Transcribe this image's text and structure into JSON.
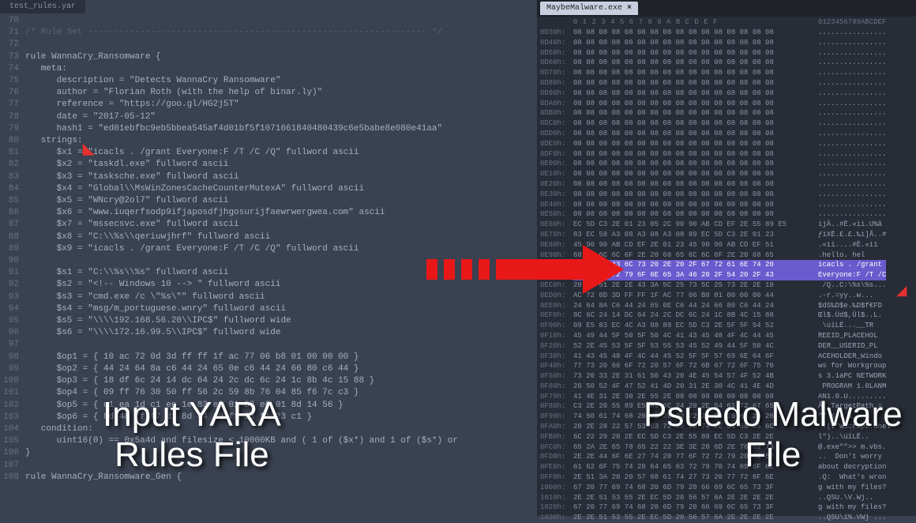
{
  "leftPanel": {
    "tab": "test_rules.yar",
    "lines": [
      {
        "n": 70,
        "t": ""
      },
      {
        "n": 71,
        "t": "/* Rule Set ----------------------------------------------------------------- */",
        "cls": "cmt"
      },
      {
        "n": 72,
        "t": ""
      },
      {
        "n": 73,
        "t": "rule WannaCry_Ransomware {"
      },
      {
        "n": 74,
        "t": "   meta:"
      },
      {
        "n": 75,
        "t": "      description = \"Detects WannaCry Ransomware\""
      },
      {
        "n": 76,
        "t": "      author = \"Florian Roth (with the help of binar.ly)\""
      },
      {
        "n": 77,
        "t": "      reference = \"https://goo.gl/HG2j5T\""
      },
      {
        "n": 78,
        "t": "      date = \"2017-05-12\""
      },
      {
        "n": 79,
        "t": "      hash1 = \"ed01ebfbc9eb5bbea545af4d01bf5f1071661840480439c6e5babe8e080e41aa\""
      },
      {
        "n": 80,
        "t": "   strings:"
      },
      {
        "n": 81,
        "t": "      $x1 = \"icacls . /grant Everyone:F /T /C /Q\" fullword ascii"
      },
      {
        "n": 82,
        "t": "      $x2 = \"taskdl.exe\" fullword ascii"
      },
      {
        "n": 83,
        "t": "      $x3 = \"tasksche.exe\" fullword ascii"
      },
      {
        "n": 84,
        "t": "      $x4 = \"Global\\\\MsWinZonesCacheCounterMutexA\" fullword ascii"
      },
      {
        "n": 85,
        "t": "      $x5 = \"WNcry@2ol7\" fullword ascii"
      },
      {
        "n": 86,
        "t": "      $x6 = \"www.iuqerfsodp9ifjaposdfjhgosurijfaewrwergwea.com\" ascii"
      },
      {
        "n": 87,
        "t": "      $x7 = \"mssecsvc.exe\" fullword ascii"
      },
      {
        "n": 88,
        "t": "      $x8 = \"C:\\\\%s\\\\qeriuwjhrf\" fullword ascii"
      },
      {
        "n": 89,
        "t": "      $x9 = \"icacls . /grant Everyone:F /T /C /Q\" fullword ascii"
      },
      {
        "n": 90,
        "t": ""
      },
      {
        "n": 91,
        "t": "      $s1 = \"C:\\\\%s\\\\%s\" fullword ascii"
      },
      {
        "n": 92,
        "t": "      $s2 = \"<!-- Windows 10 --> \" fullword ascii"
      },
      {
        "n": 93,
        "t": "      $s3 = \"cmd.exe /c \\\"%s\\\"\" fullword ascii"
      },
      {
        "n": 94,
        "t": "      $s4 = \"msg/m_portuguese.wnry\" fullword ascii"
      },
      {
        "n": 95,
        "t": "      $s5 = \"\\\\\\\\192.168.56.20\\\\IPC$\" fullword wide"
      },
      {
        "n": 96,
        "t": "      $s6 = \"\\\\\\\\172.16.99.5\\\\IPC$\" fullword wide"
      },
      {
        "n": 97,
        "t": ""
      },
      {
        "n": 98,
        "t": "      $op1 = { 10 ac 72 0d 3d ff ff 1f ac 77 06 b8 01 00 00 00 }"
      },
      {
        "n": 99,
        "t": "      $op2 = { 44 24 64 8a c6 44 24 65 0e c6 44 24 66 80 c6 44 }"
      },
      {
        "n": 100,
        "t": "      $op3 = { 18 df 6c 24 14 dc 64 24 2c dc 6c 24 1c 8b 4c 15 88 }"
      },
      {
        "n": 101,
        "t": "      $op4 = { 09 ff 76 30 50 ff 56 2c 59 8b 76 04 85 f6 7c c3 }"
      },
      {
        "n": 102,
        "t": "      $op5 = { c1 ea 1d c1 ee 1e 83 e2 01 83 e6 01 8d 14 56 }"
      },
      {
        "n": 103,
        "t": "      $op6 = { 8d 48 ff f7 d1 8d 44 10 ff 23 f1 23 c1 }"
      },
      {
        "n": 104,
        "t": "   condition:"
      },
      {
        "n": 105,
        "t": "      uint16(0) == 0x5a4d and filesize < 10000KB and ( 1 of ($x*) and 1 of ($s*) or"
      },
      {
        "n": 106,
        "t": "}"
      },
      {
        "n": 107,
        "t": ""
      },
      {
        "n": 108,
        "t": "rule WannaCry_Ransomware_Gen {"
      }
    ]
  },
  "rightPanel": {
    "tab": "MaybeMalware.exe",
    "header": {
      "offsets": "0 1 2 3 4 5 6 7 8 9 A B C D E F",
      "ascii": "0123456789ABCDEF"
    },
    "rows": [
      {
        "off": "0D30h:",
        "b": "08 08 08 08 08 08 08 08 08 08 08 08 08 08 08 08",
        "a": "................"
      },
      {
        "off": "0D40h:",
        "b": "08 08 08 08 08 08 08 08 08 08 08 08 08 08 08 08",
        "a": "................"
      },
      {
        "off": "0D50h:",
        "b": "08 08 08 08 08 08 08 08 08 08 08 08 08 08 08 08",
        "a": "................"
      },
      {
        "off": "0D60h:",
        "b": "08 08 08 08 08 08 08 08 08 08 08 08 08 08 08 08",
        "a": "................"
      },
      {
        "off": "0D70h:",
        "b": "08 08 08 08 08 08 08 08 08 08 08 08 08 08 08 08",
        "a": "................"
      },
      {
        "off": "0D80h:",
        "b": "08 08 08 08 08 08 08 08 08 08 08 08 08 08 08 08",
        "a": "................"
      },
      {
        "off": "0D90h:",
        "b": "08 08 08 08 08 08 08 08 08 08 08 08 08 08 08 08",
        "a": "................"
      },
      {
        "off": "0DA0h:",
        "b": "08 08 08 08 08 08 08 08 08 08 08 08 08 08 08 08",
        "a": "................"
      },
      {
        "off": "0DB0h:",
        "b": "08 08 08 08 08 08 08 08 08 08 08 08 08 08 08 08",
        "a": "................"
      },
      {
        "off": "0DC0h:",
        "b": "08 08 08 08 08 08 08 08 08 08 08 08 08 08 08 08",
        "a": "................"
      },
      {
        "off": "0DD0h:",
        "b": "08 08 08 08 08 08 08 08 08 08 08 08 08 08 08 08",
        "a": "................"
      },
      {
        "off": "0DE0h:",
        "b": "08 08 08 08 08 08 08 08 08 08 08 08 08 08 08 08",
        "a": "................"
      },
      {
        "off": "0DF0h:",
        "b": "08 08 08 08 08 08 08 08 08 08 08 08 08 08 08 08",
        "a": "................"
      },
      {
        "off": "0E00h:",
        "b": "08 08 08 08 08 08 08 08 08 08 08 08 08 08 08 08",
        "a": "................"
      },
      {
        "off": "0E10h:",
        "b": "08 08 08 08 08 08 08 08 08 08 08 08 08 08 08 08",
        "a": "................"
      },
      {
        "off": "0E20h:",
        "b": "08 08 08 08 08 08 08 08 08 08 08 08 08 08 08 08",
        "a": "................"
      },
      {
        "off": "0E30h:",
        "b": "08 08 08 08 08 08 08 08 08 08 08 08 08 08 08 08",
        "a": "................"
      },
      {
        "off": "0E40h:",
        "b": "08 08 08 08 08 08 08 08 08 08 08 08 08 08 08 08",
        "a": "................"
      },
      {
        "off": "0E50h:",
        "b": "08 08 08 08 08 08 08 08 08 08 08 08 08 08 08 08",
        "a": "................"
      },
      {
        "off": "0E60h:",
        "b": "EC 5D C3 2E 01 23 05 2C 90 90 AB CD EF 2E 55 89 E5",
        "a": "ìjÂ..#Ë.«ìì.U%â"
      },
      {
        "off": "0E70h:",
        "b": "83 EC 58 A3 08 A3 08 A3 08 89 EC 5D C3 2E 01 23",
        "a": "ƒìXË.£.£.‰ì]Ã..#"
      },
      {
        "off": "0E80h:",
        "b": "45 90 90 AB CD EF 2E 01 23 45 90 90 AB CD EF 51",
        "a": ".«ìì....#Ë.«ìì"
      },
      {
        "off": "0E90h:",
        "b": "68 65 6C 6C 6F 2E 20 68 65 6C 6C 6F 2E 20 68 65",
        "a": ".hello. hel"
      },
      {
        "off": "0EA0h:",
        "b": "69 63 61 63 6C 73 20 2E 20 2F 67 72 61 6E 74 20",
        "a": "icacls . /grant ",
        "hl": true
      },
      {
        "off": "0EB0h:",
        "b": "45 76 65 72 79 6F 6E 65 3A 46 20 2F 54 20 2F 43",
        "a": "Everyone:F /T /C",
        "hl": true
      },
      {
        "off": "0EC0h:",
        "b": "20 2F 51 2E 2E 43 3A 5C 25 73 5C 25 73 2E 2E 10",
        "a": " /Q..C:\\%s\\%s..."
      },
      {
        "off": "0ED0h:",
        "b": "AC 72 0D 3D FF FF 1F AC 77 06 B8 01 00 00 00 44",
        "a": ".-r.=yy..w..."
      },
      {
        "off": "0EE0h:",
        "b": "24 64 8A C6 44 24 65 0E C6 44 24 66 80 C6 44 24",
        "a": "$dS‰D$e.‰D$f€FD"
      },
      {
        "off": "0EF0h:",
        "b": "8C 6C 24 14 DC 64 24 2C DC 6C 24 1C 8B 4C 15 88",
        "a": "Œl$.Üd$,Ül$..L."
      },
      {
        "off": "0F00h:",
        "b": "09 E5 83 EC 4C A3 08 89 EC 5D C3 2E 5F 5F 54 52",
        "a": " \\úîLË...__TR"
      },
      {
        "off": "0F10h:",
        "b": "45 49 44 5F 50 5F 50 4C 41 43 45 48 4F 4C 44 45",
        "a": "REEID_PLACEHOL"
      },
      {
        "off": "0F20h:",
        "b": "52 2E 45 53 5F 5F 53 55 53 45 52 49 44 5F 50 4C",
        "a": "DER__USERID_PL"
      },
      {
        "off": "0F30h:",
        "b": "41 43 45 48 4F 4C 44 45 52 5F 5F 57 69 6E 64 6F",
        "a": "ACEHOLDER_Windo"
      },
      {
        "off": "0F40h:",
        "b": "77 73 20 66 6F 72 20 57 6F 72 6B 67 72 6F 75 70",
        "a": "ws for Workgroup"
      },
      {
        "off": "0F50h:",
        "b": "73 20 33 2E 31 61 50 43 20 4E 45 54 57 4F 52 4B",
        "a": "s 3.1aPC NETWORK"
      },
      {
        "off": "0F60h:",
        "b": "20 50 52 4F 47 52 41 4D 20 31 2E 30 4C 41 4E 4D",
        "a": " PROGRAM 1.0LANM"
      },
      {
        "off": "0F70h:",
        "b": "41 4E 31 2E 30 2E 55 2E 08 08 08 08 08 08 08 08",
        "a": "AN1.0.U........."
      },
      {
        "off": "0F80h:",
        "b": "C3 2E 20 55 89 E5 83 6C 24 20 2E 54 61 72 67 65",
        "a": "Â..TargetPath = "
      },
      {
        "off": "0F90h:",
        "b": "74 50 61 74 68 20 3D 20 22 22 20 26 20 63 20 26",
        "a": "\"\" & c & "
      },
      {
        "off": "0FA0h:",
        "b": "20 2E 28 22 57 53 63 72 69 70 74 2E 53 68 65 6C",
        "a": " .(t\"WScript.Shel"
      },
      {
        "off": "0FB0h:",
        "b": "6C 22 29 20 2E EC 5D C3 2E 55 89 EC 5D C3 2E 2E",
        "a": "l\")..\\úîLË.."
      },
      {
        "off": "0FC0h:",
        "b": "65 2A 2E 65 78 65 22 22 3E 3E 20 6D 2E 76 62 73",
        "a": "@.exe\"\">> m.vbs."
      },
      {
        "off": "0FD0h:",
        "b": "2E 2E 44 6F 6E 27 74 20 77 6F 72 72 79 20 61 62",
        "a": "..  Don't worry"
      },
      {
        "off": "0FE0h:",
        "b": "61 62 6F 75 74 20 64 65 63 72 79 70 74 69 6F 6E",
        "a": "about decryption"
      },
      {
        "off": "0FF0h:",
        "b": "2E 51 3A 20 20 57 68 61 74 27 73 20 77 72 6F 6E",
        "a": ".Q:  What's wron"
      },
      {
        "off": "1000h:",
        "b": "67 20 77 69 74 68 20 6D 79 20 66 69 6C 65 73 3F",
        "a": "g with my files?"
      },
      {
        "off": "1010h:",
        "b": "2E 2E 51 53 55 2E EC 5D 20 56 57 6A 2E 2E 2E 2E",
        "a": "..QSU.\\V.Wj.."
      },
      {
        "off": "1020h:",
        "b": "67 20 77 69 74 68 20 6D 79 20 66 69 6C 65 73 3F",
        "a": "g with my files?"
      },
      {
        "off": "1030h:",
        "b": "2E 2E 51 53 55 2E EC 5D 20 56 57 6A 2E 2E 2E 2E",
        "a": "..QSU\\ï%.VWj ..."
      }
    ]
  },
  "overlays": {
    "left": "Input YARA\nRules File",
    "right": "Psuedo Malware\nFile"
  }
}
